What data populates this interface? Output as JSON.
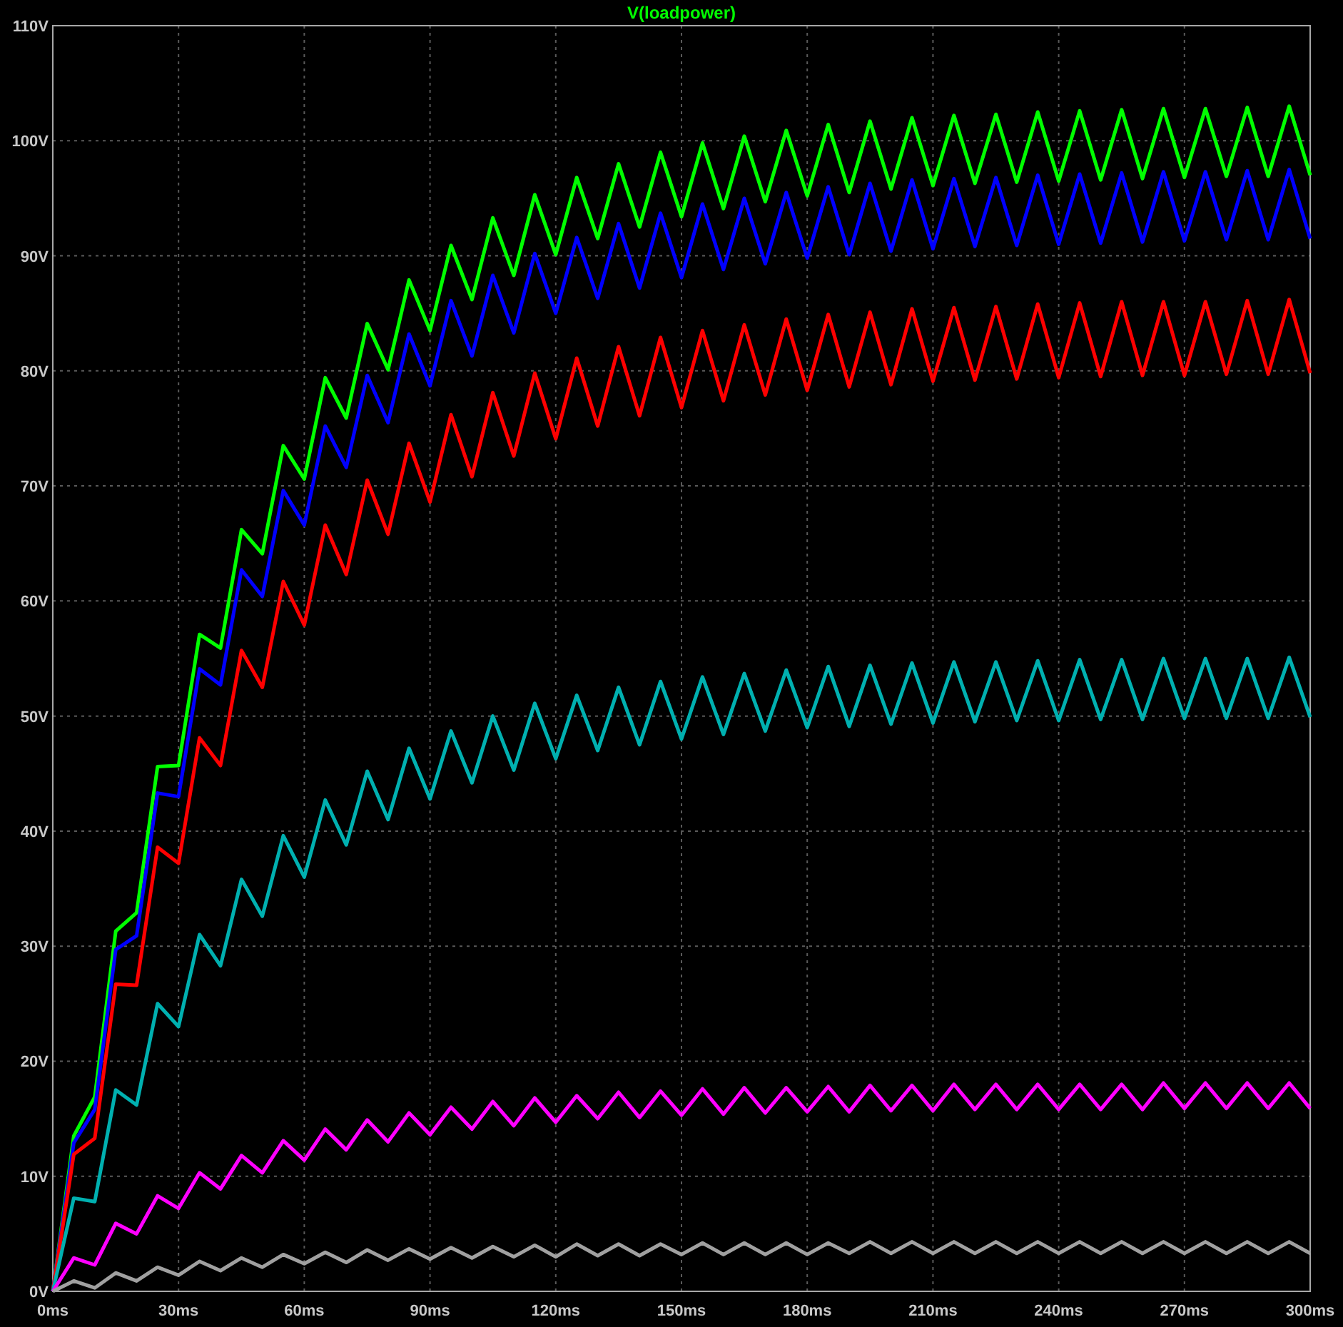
{
  "plot": {
    "chart_data": {
      "type": "line",
      "title": "V(loadpower)",
      "grid": true,
      "x": [
        0,
        5,
        10,
        15,
        20,
        25,
        30,
        35,
        40,
        45,
        50,
        55,
        60,
        65,
        70,
        75,
        80,
        85,
        90,
        95,
        100,
        105,
        110,
        115,
        120,
        125,
        130,
        135,
        140,
        145,
        150,
        155,
        160,
        165,
        170,
        175,
        180,
        185,
        190,
        195,
        200,
        205,
        210,
        215,
        220,
        225,
        230,
        235,
        240,
        245,
        250,
        255,
        260,
        265,
        270,
        275,
        280,
        285,
        290,
        295,
        300
      ],
      "xlim": [
        0,
        300
      ],
      "ylim": [
        0,
        110
      ],
      "xticks": [
        {
          "value": 0,
          "label": "0ms"
        },
        {
          "value": 30,
          "label": "30ms"
        },
        {
          "value": 60,
          "label": "60ms"
        },
        {
          "value": 90,
          "label": "90ms"
        },
        {
          "value": 120,
          "label": "120ms"
        },
        {
          "value": 150,
          "label": "150ms"
        },
        {
          "value": 180,
          "label": "180ms"
        },
        {
          "value": 210,
          "label": "210ms"
        },
        {
          "value": 240,
          "label": "240ms"
        },
        {
          "value": 270,
          "label": "270ms"
        },
        {
          "value": 300,
          "label": "300ms"
        }
      ],
      "yticks": [
        {
          "value": 0,
          "label": "0V"
        },
        {
          "value": 10,
          "label": "10V"
        },
        {
          "value": 20,
          "label": "20V"
        },
        {
          "value": 30,
          "label": "30V"
        },
        {
          "value": 40,
          "label": "40V"
        },
        {
          "value": 50,
          "label": "50V"
        },
        {
          "value": 60,
          "label": "60V"
        },
        {
          "value": 70,
          "label": "70V"
        },
        {
          "value": 80,
          "label": "80V"
        },
        {
          "value": 90,
          "label": "90V"
        },
        {
          "value": 100,
          "label": "100V"
        },
        {
          "value": 110,
          "label": "110V"
        }
      ],
      "series": [
        {
          "color": "#00ff00",
          "values": [
            0,
            13.5,
            16.9,
            31.3,
            32.9,
            45.6,
            45.7,
            57.1,
            55.9,
            66.2,
            64.1,
            73.5,
            70.6,
            79.4,
            75.9,
            84.1,
            80.1,
            87.9,
            83.5,
            90.9,
            86.2,
            93.3,
            88.3,
            95.3,
            90.1,
            96.8,
            91.5,
            98,
            92.5,
            99,
            93.4,
            99.8,
            94.1,
            100.4,
            94.7,
            100.9,
            95.2,
            101.4,
            95.5,
            101.7,
            95.8,
            102,
            96.1,
            102.2,
            96.3,
            102.3,
            96.4,
            102.5,
            96.5,
            102.6,
            96.6,
            102.7,
            96.7,
            102.8,
            96.8,
            102.8,
            96.9,
            102.9,
            96.9,
            103,
            97
          ]
        },
        {
          "color": "#0000ff",
          "values": [
            0,
            12.9,
            15.8,
            29.7,
            30.9,
            43.3,
            43,
            54.1,
            52.7,
            62.7,
            60.4,
            69.6,
            66.6,
            75.2,
            71.6,
            79.6,
            75.5,
            83.2,
            78.7,
            86.1,
            81.3,
            88.3,
            83.3,
            90.2,
            85,
            91.6,
            86.3,
            92.8,
            87.2,
            93.7,
            88.1,
            94.5,
            88.8,
            95,
            89.3,
            95.5,
            89.8,
            96,
            90.1,
            96.3,
            90.4,
            96.6,
            90.6,
            96.7,
            90.8,
            96.8,
            90.9,
            97,
            91,
            97.1,
            91.1,
            97.2,
            91.2,
            97.3,
            91.3,
            97.3,
            91.4,
            97.4,
            91.4,
            97.5,
            91.5
          ]
        },
        {
          "color": "#ff0000",
          "values": [
            0,
            11.9,
            13.3,
            26.7,
            26.6,
            38.6,
            37.2,
            48.1,
            45.7,
            55.7,
            52.5,
            61.7,
            57.9,
            66.6,
            62.3,
            70.5,
            65.8,
            73.7,
            68.6,
            76.2,
            70.8,
            78.1,
            72.6,
            79.8,
            74.1,
            81.1,
            75.2,
            82.1,
            76.1,
            82.9,
            76.8,
            83.5,
            77.4,
            84,
            77.9,
            84.5,
            78.3,
            84.9,
            78.6,
            85.1,
            78.8,
            85.4,
            79.1,
            85.5,
            79.2,
            85.6,
            79.3,
            85.8,
            79.4,
            85.9,
            79.5,
            86,
            79.6,
            86,
            79.6,
            86,
            79.7,
            86.1,
            79.7,
            86.2,
            79.8
          ]
        },
        {
          "color": "#00b0b0",
          "values": [
            0,
            8.1,
            7.8,
            17.5,
            16.2,
            25,
            23,
            31,
            28.3,
            35.8,
            32.6,
            39.6,
            36,
            42.7,
            38.8,
            45.2,
            41,
            47.2,
            42.8,
            48.7,
            44.2,
            50,
            45.3,
            51.1,
            46.3,
            51.8,
            47,
            52.5,
            47.5,
            53,
            48,
            53.4,
            48.4,
            53.7,
            48.7,
            54,
            49,
            54.3,
            49.1,
            54.4,
            49.3,
            54.6,
            49.4,
            54.7,
            49.5,
            54.7,
            49.6,
            54.8,
            49.6,
            54.9,
            49.7,
            54.9,
            49.7,
            55,
            49.8,
            55,
            49.8,
            55,
            49.8,
            55.1,
            49.9
          ]
        },
        {
          "color": "#ff00ff",
          "values": [
            0,
            2.9,
            2.3,
            5.9,
            5,
            8.3,
            7.2,
            10.3,
            8.9,
            11.8,
            10.3,
            13.1,
            11.4,
            14.1,
            12.3,
            14.9,
            13,
            15.5,
            13.6,
            16,
            14.1,
            16.5,
            14.4,
            16.8,
            14.7,
            17,
            15,
            17.3,
            15.1,
            17.4,
            15.3,
            17.6,
            15.4,
            17.7,
            15.5,
            17.7,
            15.6,
            17.8,
            15.6,
            17.9,
            15.7,
            17.9,
            15.7,
            18,
            15.8,
            18,
            15.8,
            18,
            15.8,
            18,
            15.8,
            18,
            15.8,
            18.1,
            15.9,
            18.1,
            15.9,
            18.1,
            15.9,
            18.1,
            15.9
          ]
        },
        {
          "color": "#a0a0a0",
          "values": [
            0,
            0.9,
            0.3,
            1.6,
            0.9,
            2.1,
            1.4,
            2.6,
            1.8,
            2.9,
            2.1,
            3.2,
            2.4,
            3.4,
            2.5,
            3.6,
            2.7,
            3.7,
            2.8,
            3.8,
            2.9,
            3.9,
            3,
            4,
            3,
            4.1,
            3.1,
            4.1,
            3.1,
            4.1,
            3.2,
            4.2,
            3.2,
            4.2,
            3.2,
            4.2,
            3.2,
            4.2,
            3.3,
            4.3,
            3.3,
            4.3,
            3.3,
            4.3,
            3.3,
            4.3,
            3.3,
            4.3,
            3.3,
            4.3,
            3.3,
            4.3,
            3.3,
            4.3,
            3.3,
            4.3,
            3.3,
            4.3,
            3.3,
            4.3,
            3.3
          ]
        }
      ]
    }
  }
}
